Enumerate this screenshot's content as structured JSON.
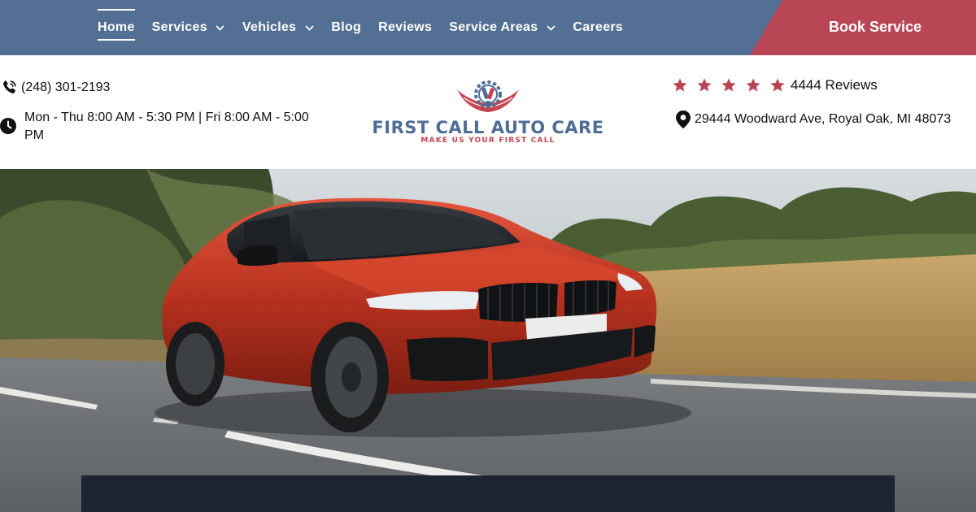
{
  "nav": {
    "items": [
      {
        "label": "Home",
        "active": true,
        "dropdown": false
      },
      {
        "label": "Services",
        "active": false,
        "dropdown": true
      },
      {
        "label": "Vehicles",
        "active": false,
        "dropdown": true
      },
      {
        "label": "Blog",
        "active": false,
        "dropdown": false
      },
      {
        "label": "Reviews",
        "active": false,
        "dropdown": false
      },
      {
        "label": "Service Areas",
        "active": false,
        "dropdown": true
      },
      {
        "label": "Careers",
        "active": false,
        "dropdown": false
      }
    ],
    "cta_label": "Book Service"
  },
  "contact": {
    "phone": "(248) 301-2193",
    "phone_icon": "phone-icon",
    "hours": "Mon - Thu 8:00 AM - 5:30 PM | Fri 8:00 AM - 5:00 PM",
    "hours_icon": "clock-icon"
  },
  "logo": {
    "title": "FIRST CALL AUTO CARE",
    "tagline": "MAKE US YOUR FIRST CALL"
  },
  "rating": {
    "stars": 5,
    "reviews_text": "4444 Reviews",
    "star_icon": "star-icon"
  },
  "address": {
    "text": "29444 Woodward Ave, Royal Oak, MI 48073",
    "icon": "map-pin-icon"
  },
  "hero": {
    "image": "red-sports-sedan-on-road"
  },
  "colors": {
    "nav_bg": "#536f93",
    "cta_bg": "#b94654",
    "star": "#b94654",
    "panel": "#1c2432",
    "logo_blue": "#4e6d94",
    "logo_red": "#c4444f"
  }
}
